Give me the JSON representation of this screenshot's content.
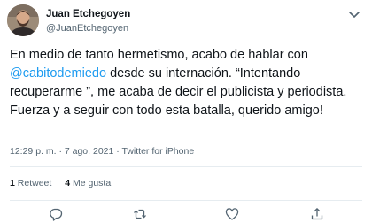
{
  "author": {
    "name": "Juan Etchegoyen",
    "handle": "@JuanEtchegoyen"
  },
  "tweet": {
    "text_before": "En medio de tanto hermetismo, acabo de hablar con ",
    "mention": "@cabitodemiedo",
    "text_after": " desde su internación. “Intentando recuperarme ”, me acaba de decir el publicista y periodista. Fuerza y a seguir con todo esta batalla, querido amigo!"
  },
  "meta": {
    "time": "12:29 p. m.",
    "separator": "·",
    "date": "7 ago. 2021",
    "source": "Twitter for iPhone"
  },
  "stats": {
    "retweets_count": "1",
    "retweets_label": "Retweet",
    "likes_count": "4",
    "likes_label": "Me gusta"
  },
  "colors": {
    "link": "#1d9bf0",
    "secondary_text": "#536471",
    "divider": "#e6ecf0"
  },
  "icons": [
    "more-options-icon",
    "reply-icon",
    "retweet-icon",
    "like-icon",
    "share-icon"
  ]
}
